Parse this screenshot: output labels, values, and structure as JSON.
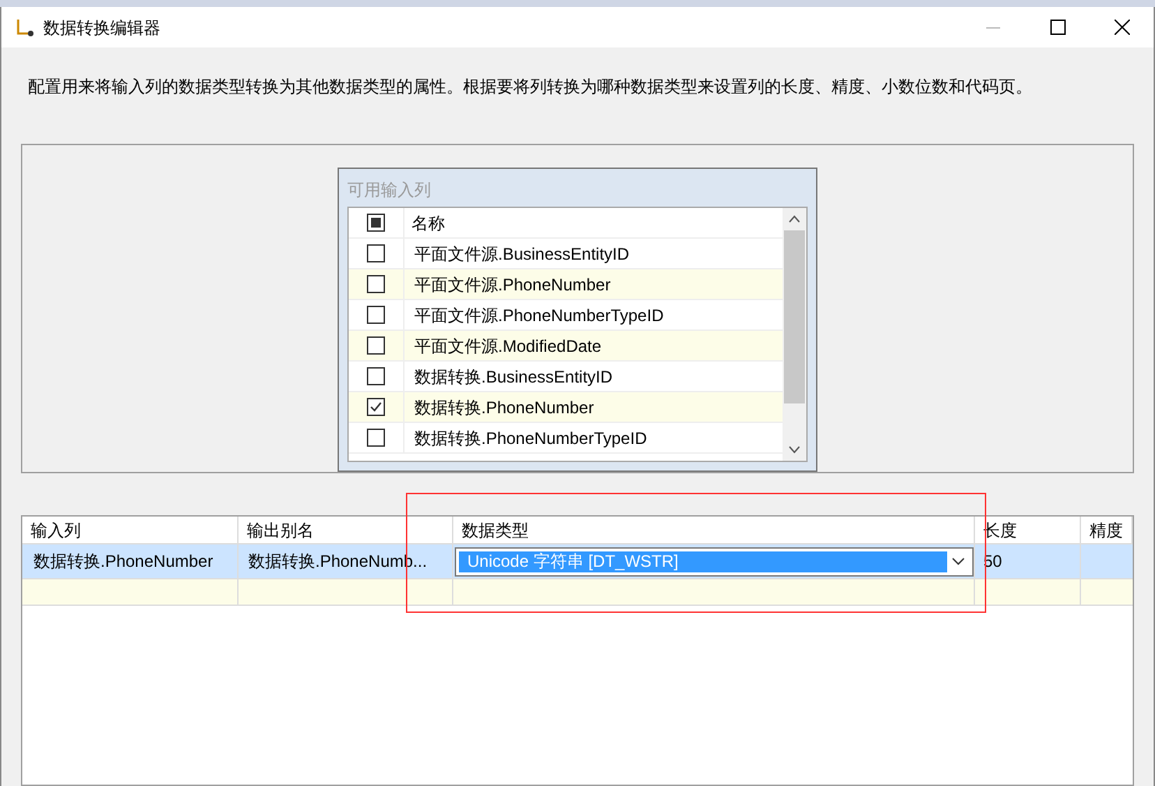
{
  "window": {
    "title": "数据转换编辑器"
  },
  "description": "配置用来将输入列的数据类型转换为其他数据类型的属性。根据要将列转换为哪种数据类型来设置列的长度、精度、小数位数和代码页。",
  "input_columns": {
    "title": "可用输入列",
    "header": {
      "label": "名称",
      "checked": false,
      "indeterminate": true
    },
    "rows": [
      {
        "name": "平面文件源.BusinessEntityID",
        "checked": false
      },
      {
        "name": "平面文件源.PhoneNumber",
        "checked": false
      },
      {
        "name": "平面文件源.PhoneNumberTypeID",
        "checked": false
      },
      {
        "name": "平面文件源.ModifiedDate",
        "checked": false
      },
      {
        "name": "数据转换.BusinessEntityID",
        "checked": false
      },
      {
        "name": "数据转换.PhoneNumber",
        "checked": true
      },
      {
        "name": "数据转换.PhoneNumberTypeID",
        "checked": false
      }
    ]
  },
  "grid": {
    "columns": [
      "输入列",
      "输出别名",
      "数据类型",
      "长度",
      "精度"
    ],
    "rows": [
      {
        "input": "数据转换.PhoneNumber",
        "alias": "数据转换.PhoneNumb...",
        "type": "Unicode 字符串 [DT_WSTR]",
        "length": "50",
        "selected": true
      }
    ]
  }
}
